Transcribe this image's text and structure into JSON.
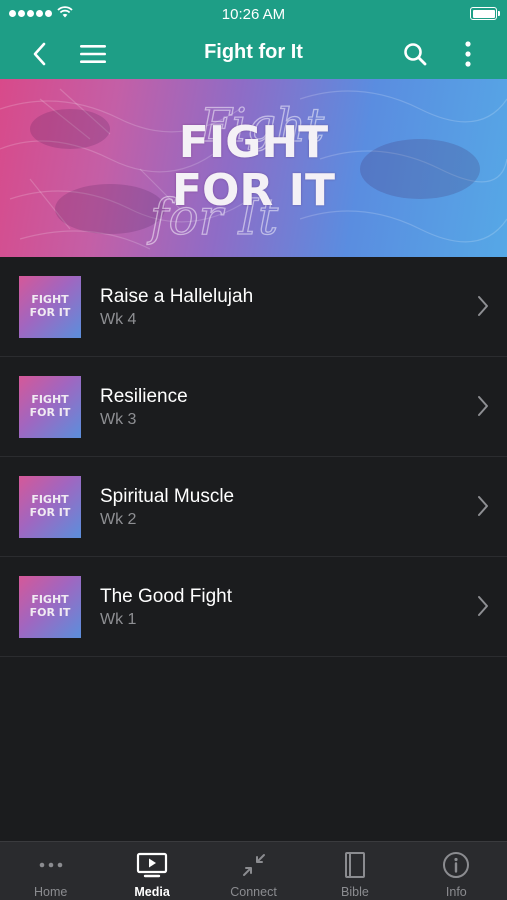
{
  "status_bar": {
    "time": "10:26 AM"
  },
  "header": {
    "title": "Fight for It"
  },
  "banner": {
    "line1": "FIGHT",
    "line2": "FOR IT"
  },
  "thumbnail_text": {
    "line1": "FIGHT",
    "line2": "FOR IT"
  },
  "episodes": [
    {
      "title": "Raise a Hallelujah",
      "subtitle": "Wk 4"
    },
    {
      "title": "Resilience",
      "subtitle": "Wk 3"
    },
    {
      "title": "Spiritual Muscle",
      "subtitle": "Wk 2"
    },
    {
      "title": "The Good Fight",
      "subtitle": "Wk 1"
    }
  ],
  "tabs": [
    {
      "label": "Home",
      "icon": "more-dots-icon",
      "active": false
    },
    {
      "label": "Media",
      "icon": "tv-play-icon",
      "active": true
    },
    {
      "label": "Connect",
      "icon": "arrows-inward-icon",
      "active": false
    },
    {
      "label": "Bible",
      "icon": "book-icon",
      "active": false
    },
    {
      "label": "Info",
      "icon": "info-icon",
      "active": false
    }
  ],
  "colors": {
    "accent": "#1e9e86",
    "background": "#1b1c1e",
    "tab_bar": "#2a2b2e"
  }
}
